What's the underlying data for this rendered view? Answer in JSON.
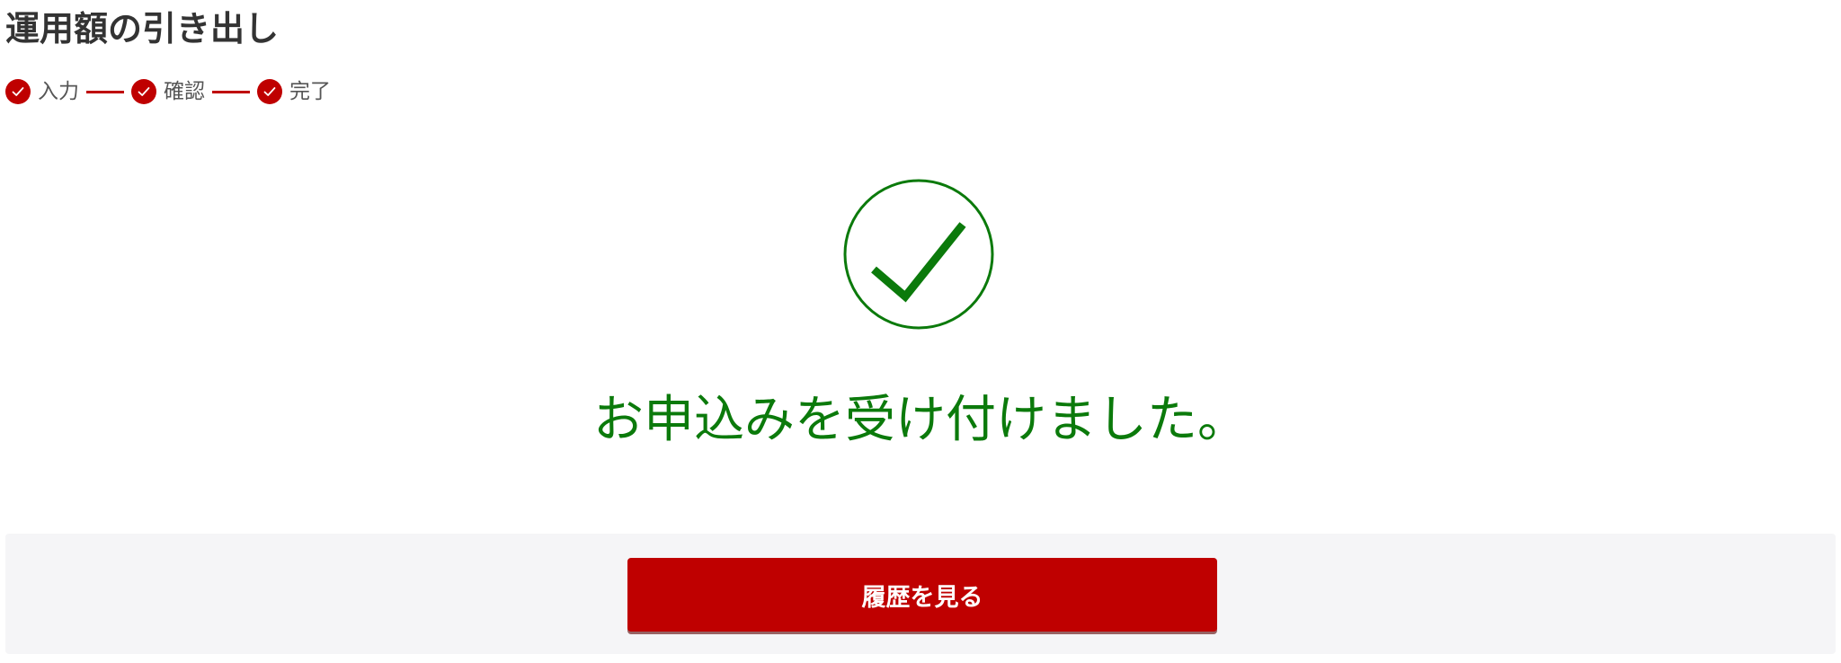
{
  "page": {
    "title": "運用額の引き出し"
  },
  "stepper": {
    "steps": [
      {
        "label": "入力",
        "icon": "check-circle-icon",
        "completed": true
      },
      {
        "label": "確認",
        "icon": "check-circle-icon",
        "completed": true
      },
      {
        "label": "完了",
        "icon": "check-circle-icon",
        "completed": true
      }
    ]
  },
  "result": {
    "icon": "success-check-icon",
    "message": "お申込みを受け付けました。"
  },
  "actions": {
    "history_button_label": "履歴を見る"
  },
  "colors": {
    "accent_red": "#bf0000",
    "success_green": "#0b7a0b",
    "title_text": "#333333",
    "step_text": "#555555",
    "footer_background": "#f5f5f7"
  }
}
